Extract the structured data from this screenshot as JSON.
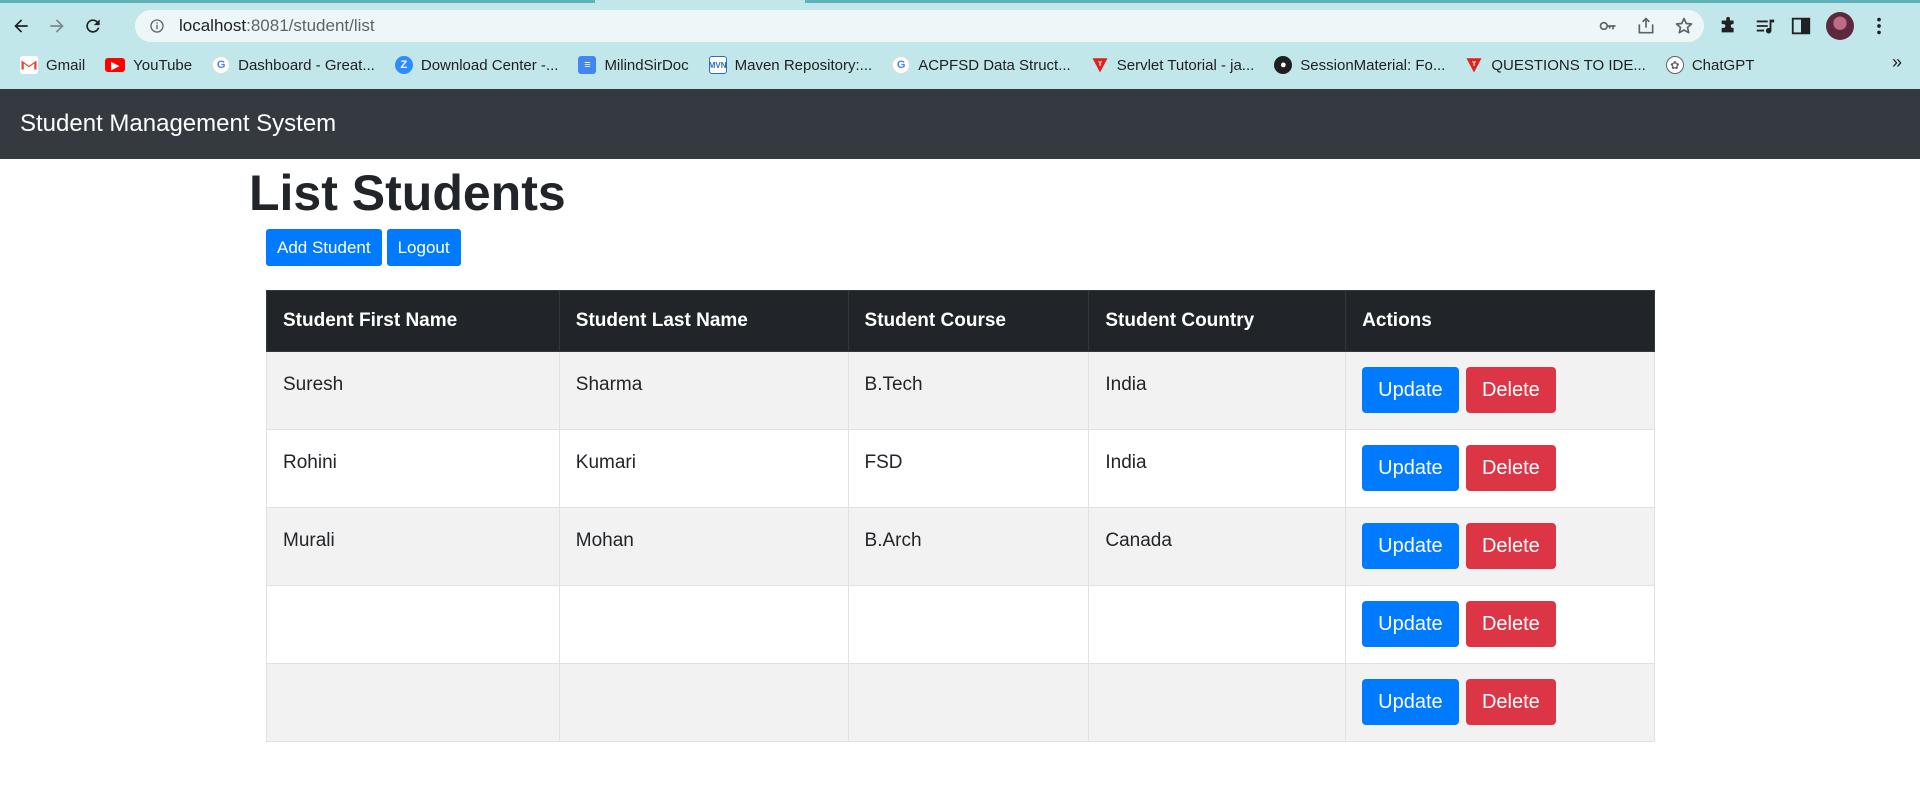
{
  "browser": {
    "url_host": "localhost",
    "url_path": ":8081/student/list",
    "bookmarks": [
      {
        "label": "Gmail",
        "icon": "gmail-icon"
      },
      {
        "label": "YouTube",
        "icon": "youtube-icon"
      },
      {
        "label": "Dashboard - Great...",
        "icon": "google-icon"
      },
      {
        "label": "Download Center -...",
        "icon": "zoom-icon"
      },
      {
        "label": "MilindSirDoc",
        "icon": "docs-icon"
      },
      {
        "label": "Maven Repository:...",
        "icon": "maven-icon"
      },
      {
        "label": "ACPFSD Data Struct...",
        "icon": "google-icon"
      },
      {
        "label": "Servlet Tutorial - ja...",
        "icon": "javatpoint-icon"
      },
      {
        "label": "SessionMaterial: Fo...",
        "icon": "github-icon"
      },
      {
        "label": "QUESTIONS TO IDE...",
        "icon": "javatpoint-icon"
      },
      {
        "label": "ChatGPT",
        "icon": "chatgpt-icon"
      }
    ],
    "more_bookmarks": "»"
  },
  "app": {
    "brand": "Student Management System"
  },
  "page": {
    "title": "List Students",
    "add_button": "Add Student",
    "logout_button": "Logout"
  },
  "table": {
    "headers": [
      "Student First Name",
      "Student Last Name",
      "Student Course",
      "Student Country",
      "Actions"
    ],
    "rows": [
      {
        "first": "Suresh",
        "last": "Sharma",
        "course": "B.Tech",
        "country": "India"
      },
      {
        "first": "Rohini",
        "last": "Kumari",
        "course": "FSD",
        "country": "India"
      },
      {
        "first": "Murali",
        "last": "Mohan",
        "course": "B.Arch",
        "country": "Canada"
      },
      {
        "first": "",
        "last": "",
        "course": "",
        "country": ""
      },
      {
        "first": "",
        "last": "",
        "course": "",
        "country": ""
      }
    ],
    "update_label": "Update",
    "delete_label": "Delete"
  },
  "colors": {
    "navbar": "#343a40",
    "primary": "#007bff",
    "danger": "#dc3545",
    "table_header": "#212529",
    "chrome": "#c2e7ea"
  }
}
